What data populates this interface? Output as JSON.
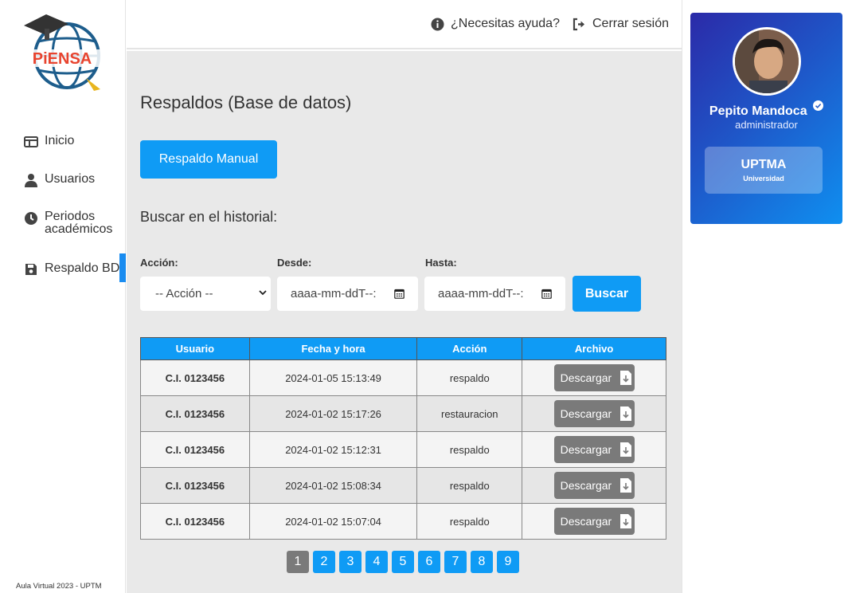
{
  "logo": {
    "text": "PiENSA"
  },
  "sidebar": {
    "items": [
      {
        "label": "Inicio",
        "icon": "layout-icon"
      },
      {
        "label": "Usuarios",
        "icon": "user-icon"
      },
      {
        "label": "Periodos",
        "label2": "académicos",
        "icon": "clock-icon"
      },
      {
        "label": "Respaldo BD",
        "icon": "floppy-disk-icon",
        "active": true
      }
    ],
    "footer": "Aula Virtual 2023 - UPTM"
  },
  "topbar": {
    "help_label": "¿Necesitas ayuda?",
    "logout_label": "Cerrar sesión"
  },
  "main": {
    "title": "Respaldos (Base de datos)",
    "manual_button": "Respaldo Manual",
    "search_title": "Buscar en el historial:",
    "filters": {
      "action_label": "Acción:",
      "action_value": "-- Acción --",
      "from_label": "Desde:",
      "from_placeholder": "aaaa-mm-ddT--:",
      "to_label": "Hasta:",
      "to_placeholder": "aaaa-mm-ddT--:",
      "search_button": "Buscar"
    },
    "table": {
      "headers": [
        "Usuario",
        "Fecha y hora",
        "Acción",
        "Archivo"
      ],
      "download_label": "Descargar",
      "rows": [
        {
          "user": "C.I. 0123456",
          "datetime": "2024-01-05 15:13:49",
          "action": "respaldo"
        },
        {
          "user": "C.I. 0123456",
          "datetime": "2024-01-02 15:17:26",
          "action": "restauracion"
        },
        {
          "user": "C.I. 0123456",
          "datetime": "2024-01-02 15:12:31",
          "action": "respaldo"
        },
        {
          "user": "C.I. 0123456",
          "datetime": "2024-01-02 15:08:34",
          "action": "respaldo"
        },
        {
          "user": "C.I. 0123456",
          "datetime": "2024-01-02 15:07:04",
          "action": "respaldo"
        }
      ]
    },
    "pagination": {
      "pages": [
        "1",
        "2",
        "3",
        "4",
        "5",
        "6",
        "7",
        "8",
        "9"
      ],
      "current": "1"
    }
  },
  "profile": {
    "name": "Pepito Mandoca",
    "role": "administrador",
    "university": "UPTMA",
    "university_type": "Universidad"
  },
  "colors": {
    "accent": "#0f9bf5",
    "card_start": "#2b2aa8",
    "card_end": "#0f8ff0",
    "muted_button": "#7a7a7a"
  }
}
